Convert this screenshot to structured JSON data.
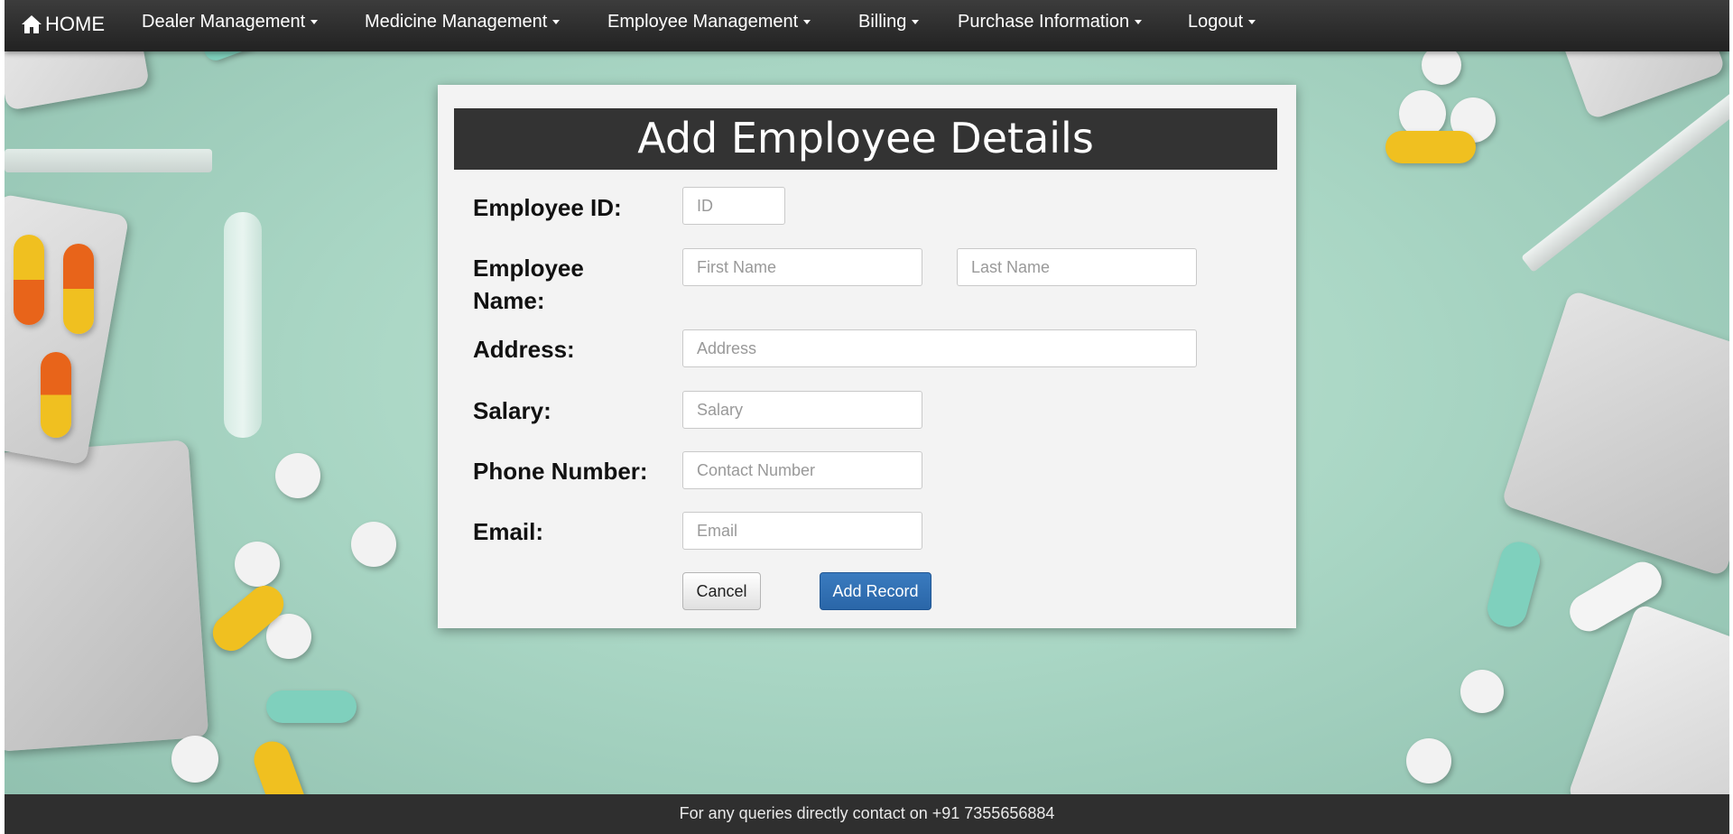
{
  "navbar": {
    "home_label": "HOME",
    "items": [
      {
        "label": "Dealer Management"
      },
      {
        "label": "Medicine Management"
      },
      {
        "label": "Employee Management"
      },
      {
        "label": "Billing"
      },
      {
        "label": "Purchase Information"
      },
      {
        "label": "Logout"
      }
    ]
  },
  "form": {
    "title": "Add Employee Details",
    "labels": {
      "employee_id": "Employee ID:",
      "employee_name_line1": "Employee",
      "employee_name_line2": "Name:",
      "address": "Address:",
      "salary": "Salary:",
      "phone": "Phone Number:",
      "email": "Email:"
    },
    "placeholders": {
      "id": "ID",
      "first_name": "First Name",
      "last_name": "Last Name",
      "address": "Address",
      "salary": "Salary",
      "contact": "Contact Number",
      "email": "Email"
    },
    "buttons": {
      "cancel": "Cancel",
      "add": "Add Record"
    }
  },
  "footer": {
    "text": "For any queries directly contact on +91 7355656884"
  },
  "colors": {
    "navbar": "#2b2b2b",
    "header": "#333333",
    "primary_button": "#2a66a8",
    "background": "#a9d6c4"
  }
}
